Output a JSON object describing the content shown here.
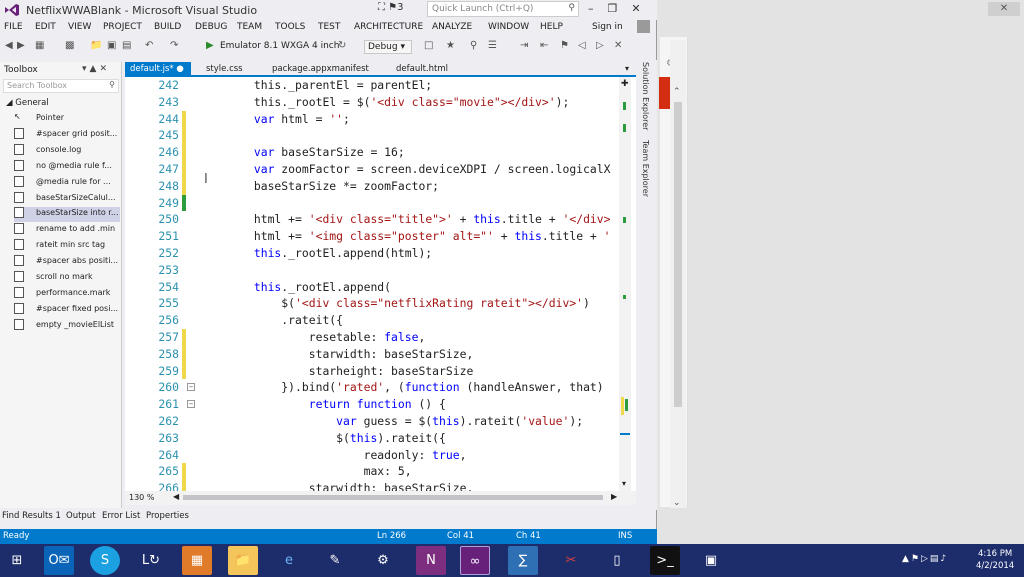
{
  "window": {
    "title": "NetflixWWABlank - Microsoft Visual Studio",
    "quick_launch_placeholder": "Quick Launch (Ctrl+Q)",
    "notification_count": "3",
    "sign_in": "Sign in"
  },
  "menu": [
    "FILE",
    "EDIT",
    "VIEW",
    "PROJECT",
    "BUILD",
    "DEBUG",
    "TEAM",
    "TOOLS",
    "TEST",
    "ARCHITECTURE",
    "ANALYZE",
    "WINDOW",
    "HELP"
  ],
  "toolbar": {
    "run_target": "Emulator 8.1 WXGA 4 inch",
    "configuration": "Debug"
  },
  "toolbox": {
    "title": "Toolbox",
    "search_placeholder": "Search Toolbox",
    "group": "General",
    "items": [
      {
        "label": "Pointer",
        "selected": false
      },
      {
        "label": "#spacer grid posit...",
        "selected": false
      },
      {
        "label": "console.log",
        "selected": false
      },
      {
        "label": "no @media rule f...",
        "selected": false
      },
      {
        "label": "@media rule for ...",
        "selected": false
      },
      {
        "label": "baseStarSizeCalul...",
        "selected": false
      },
      {
        "label": "baseStarSize into r...",
        "selected": true
      },
      {
        "label": "rename to add .min",
        "selected": false
      },
      {
        "label": "rateit min src tag",
        "selected": false
      },
      {
        "label": "#spacer abs positi...",
        "selected": false
      },
      {
        "label": "scroll no mark",
        "selected": false
      },
      {
        "label": "performance.mark",
        "selected": false
      },
      {
        "label": "#spacer fixed posi...",
        "selected": false
      },
      {
        "label": "empty _movieElList",
        "selected": false
      }
    ]
  },
  "tabs": [
    {
      "label": "default.js*",
      "active": true
    },
    {
      "label": "style.css",
      "active": false
    },
    {
      "label": "package.appxmanifest",
      "active": false
    },
    {
      "label": "default.html",
      "active": false
    }
  ],
  "code": [
    {
      "n": "242",
      "mark": "",
      "fold": "",
      "tokens": [
        [
          "",
          "        this._parentEl = parentEl;"
        ]
      ]
    },
    {
      "n": "243",
      "mark": "",
      "fold": "",
      "tokens": [
        [
          "",
          "        this._rootEl = $("
        ],
        [
          "s",
          "'<div class=\"movie\"></div>'"
        ],
        [
          "",
          ");"
        ]
      ]
    },
    {
      "n": "244",
      "mark": "y",
      "fold": "",
      "tokens": [
        [
          "k",
          "        var"
        ],
        [
          "",
          " html = "
        ],
        [
          "s",
          "''"
        ],
        [
          "",
          ";"
        ]
      ]
    },
    {
      "n": "245",
      "mark": "y",
      "fold": "",
      "tokens": [
        [
          "",
          ""
        ]
      ]
    },
    {
      "n": "246",
      "mark": "y",
      "fold": "",
      "tokens": [
        [
          "k",
          "        var"
        ],
        [
          "",
          " baseStarSize = 16;"
        ]
      ]
    },
    {
      "n": "247",
      "mark": "y",
      "fold": "",
      "tokens": [
        [
          "k",
          "        var"
        ],
        [
          "",
          " zoomFactor = screen.deviceXDPI / screen.logicalX"
        ]
      ]
    },
    {
      "n": "248",
      "mark": "y",
      "fold": "",
      "tokens": [
        [
          "",
          "        baseStarSize *= zoomFactor;"
        ]
      ]
    },
    {
      "n": "249",
      "mark": "g",
      "fold": "",
      "tokens": [
        [
          "",
          ""
        ]
      ]
    },
    {
      "n": "250",
      "mark": "",
      "fold": "",
      "tokens": [
        [
          "",
          "        html += "
        ],
        [
          "s",
          "'<div class=\"title\">'"
        ],
        [
          "",
          " + "
        ],
        [
          "k",
          "this"
        ],
        [
          "",
          ".title + "
        ],
        [
          "s",
          "'</div>"
        ]
      ]
    },
    {
      "n": "251",
      "mark": "",
      "fold": "",
      "tokens": [
        [
          "",
          "        html += "
        ],
        [
          "s",
          "'<img class=\"poster\" alt=\"'"
        ],
        [
          "",
          " + "
        ],
        [
          "k",
          "this"
        ],
        [
          "",
          ".title + "
        ],
        [
          "s",
          "'"
        ]
      ]
    },
    {
      "n": "252",
      "mark": "",
      "fold": "",
      "tokens": [
        [
          "k",
          "        this"
        ],
        [
          "",
          "._rootEl.append(html);"
        ]
      ]
    },
    {
      "n": "253",
      "mark": "",
      "fold": "",
      "tokens": [
        [
          "",
          ""
        ]
      ]
    },
    {
      "n": "254",
      "mark": "",
      "fold": "",
      "tokens": [
        [
          "k",
          "        this"
        ],
        [
          "",
          "._rootEl.append("
        ]
      ]
    },
    {
      "n": "255",
      "mark": "",
      "fold": "",
      "tokens": [
        [
          "",
          "            $("
        ],
        [
          "s",
          "'<div class=\"netflixRating rateit\"></div>'"
        ],
        [
          "",
          ")"
        ]
      ]
    },
    {
      "n": "256",
      "mark": "",
      "fold": "",
      "tokens": [
        [
          "",
          "            .rateit({"
        ]
      ]
    },
    {
      "n": "257",
      "mark": "y",
      "fold": "",
      "tokens": [
        [
          "",
          "                resetable: "
        ],
        [
          "k",
          "false"
        ],
        [
          "",
          ","
        ]
      ]
    },
    {
      "n": "258",
      "mark": "y",
      "fold": "",
      "tokens": [
        [
          "",
          "                starwidth: baseStarSize,"
        ]
      ]
    },
    {
      "n": "259",
      "mark": "y",
      "fold": "",
      "tokens": [
        [
          "",
          "                starheight: baseStarSize"
        ]
      ]
    },
    {
      "n": "260",
      "mark": "",
      "fold": "-",
      "tokens": [
        [
          "",
          "            }).bind("
        ],
        [
          "s",
          "'rated'"
        ],
        [
          "",
          ", ("
        ],
        [
          "k",
          "function"
        ],
        [
          "",
          " (handleAnswer, that)"
        ]
      ]
    },
    {
      "n": "261",
      "mark": "",
      "fold": "-",
      "tokens": [
        [
          "k",
          "                return function"
        ],
        [
          "",
          " () {"
        ]
      ]
    },
    {
      "n": "262",
      "mark": "",
      "fold": "",
      "tokens": [
        [
          "k",
          "                    var"
        ],
        [
          "",
          " guess = $("
        ],
        [
          "k",
          "this"
        ],
        [
          "",
          ").rateit("
        ],
        [
          "s",
          "'value'"
        ],
        [
          "",
          ");"
        ]
      ]
    },
    {
      "n": "263",
      "mark": "",
      "fold": "",
      "tokens": [
        [
          "",
          "                    $("
        ],
        [
          "k",
          "this"
        ],
        [
          "",
          ").rateit({"
        ]
      ]
    },
    {
      "n": "264",
      "mark": "",
      "fold": "",
      "tokens": [
        [
          "",
          "                        readonly: "
        ],
        [
          "k",
          "true"
        ],
        [
          "",
          ","
        ]
      ]
    },
    {
      "n": "265",
      "mark": "y",
      "fold": "",
      "tokens": [
        [
          "",
          "                        max: 5,"
        ]
      ]
    },
    {
      "n": "266",
      "mark": "y",
      "fold": "",
      "tokens": [
        [
          "",
          "                starwidth: baseStarSize,"
        ]
      ]
    }
  ],
  "editor": {
    "zoom": "130 %"
  },
  "side_panels": [
    "Solution Explorer",
    "Team Explorer"
  ],
  "bottom_tabs": [
    "Find Results 1",
    "Output",
    "Error List",
    "Properties"
  ],
  "status": {
    "state": "Ready",
    "line": "Ln 266",
    "col": "Col 41",
    "ch": "Ch 41",
    "mode": "INS"
  },
  "taskbar": {
    "time": "4:16 PM",
    "date": "4/2/2014"
  },
  "colors": {
    "accent": "#007acc",
    "taskbar": "#1d2d6b",
    "keyword": "#0000ff",
    "string": "#a31515",
    "line_number": "#2b91af",
    "change_saved": "#2d9c3c",
    "change_unsaved": "#efd84a"
  }
}
